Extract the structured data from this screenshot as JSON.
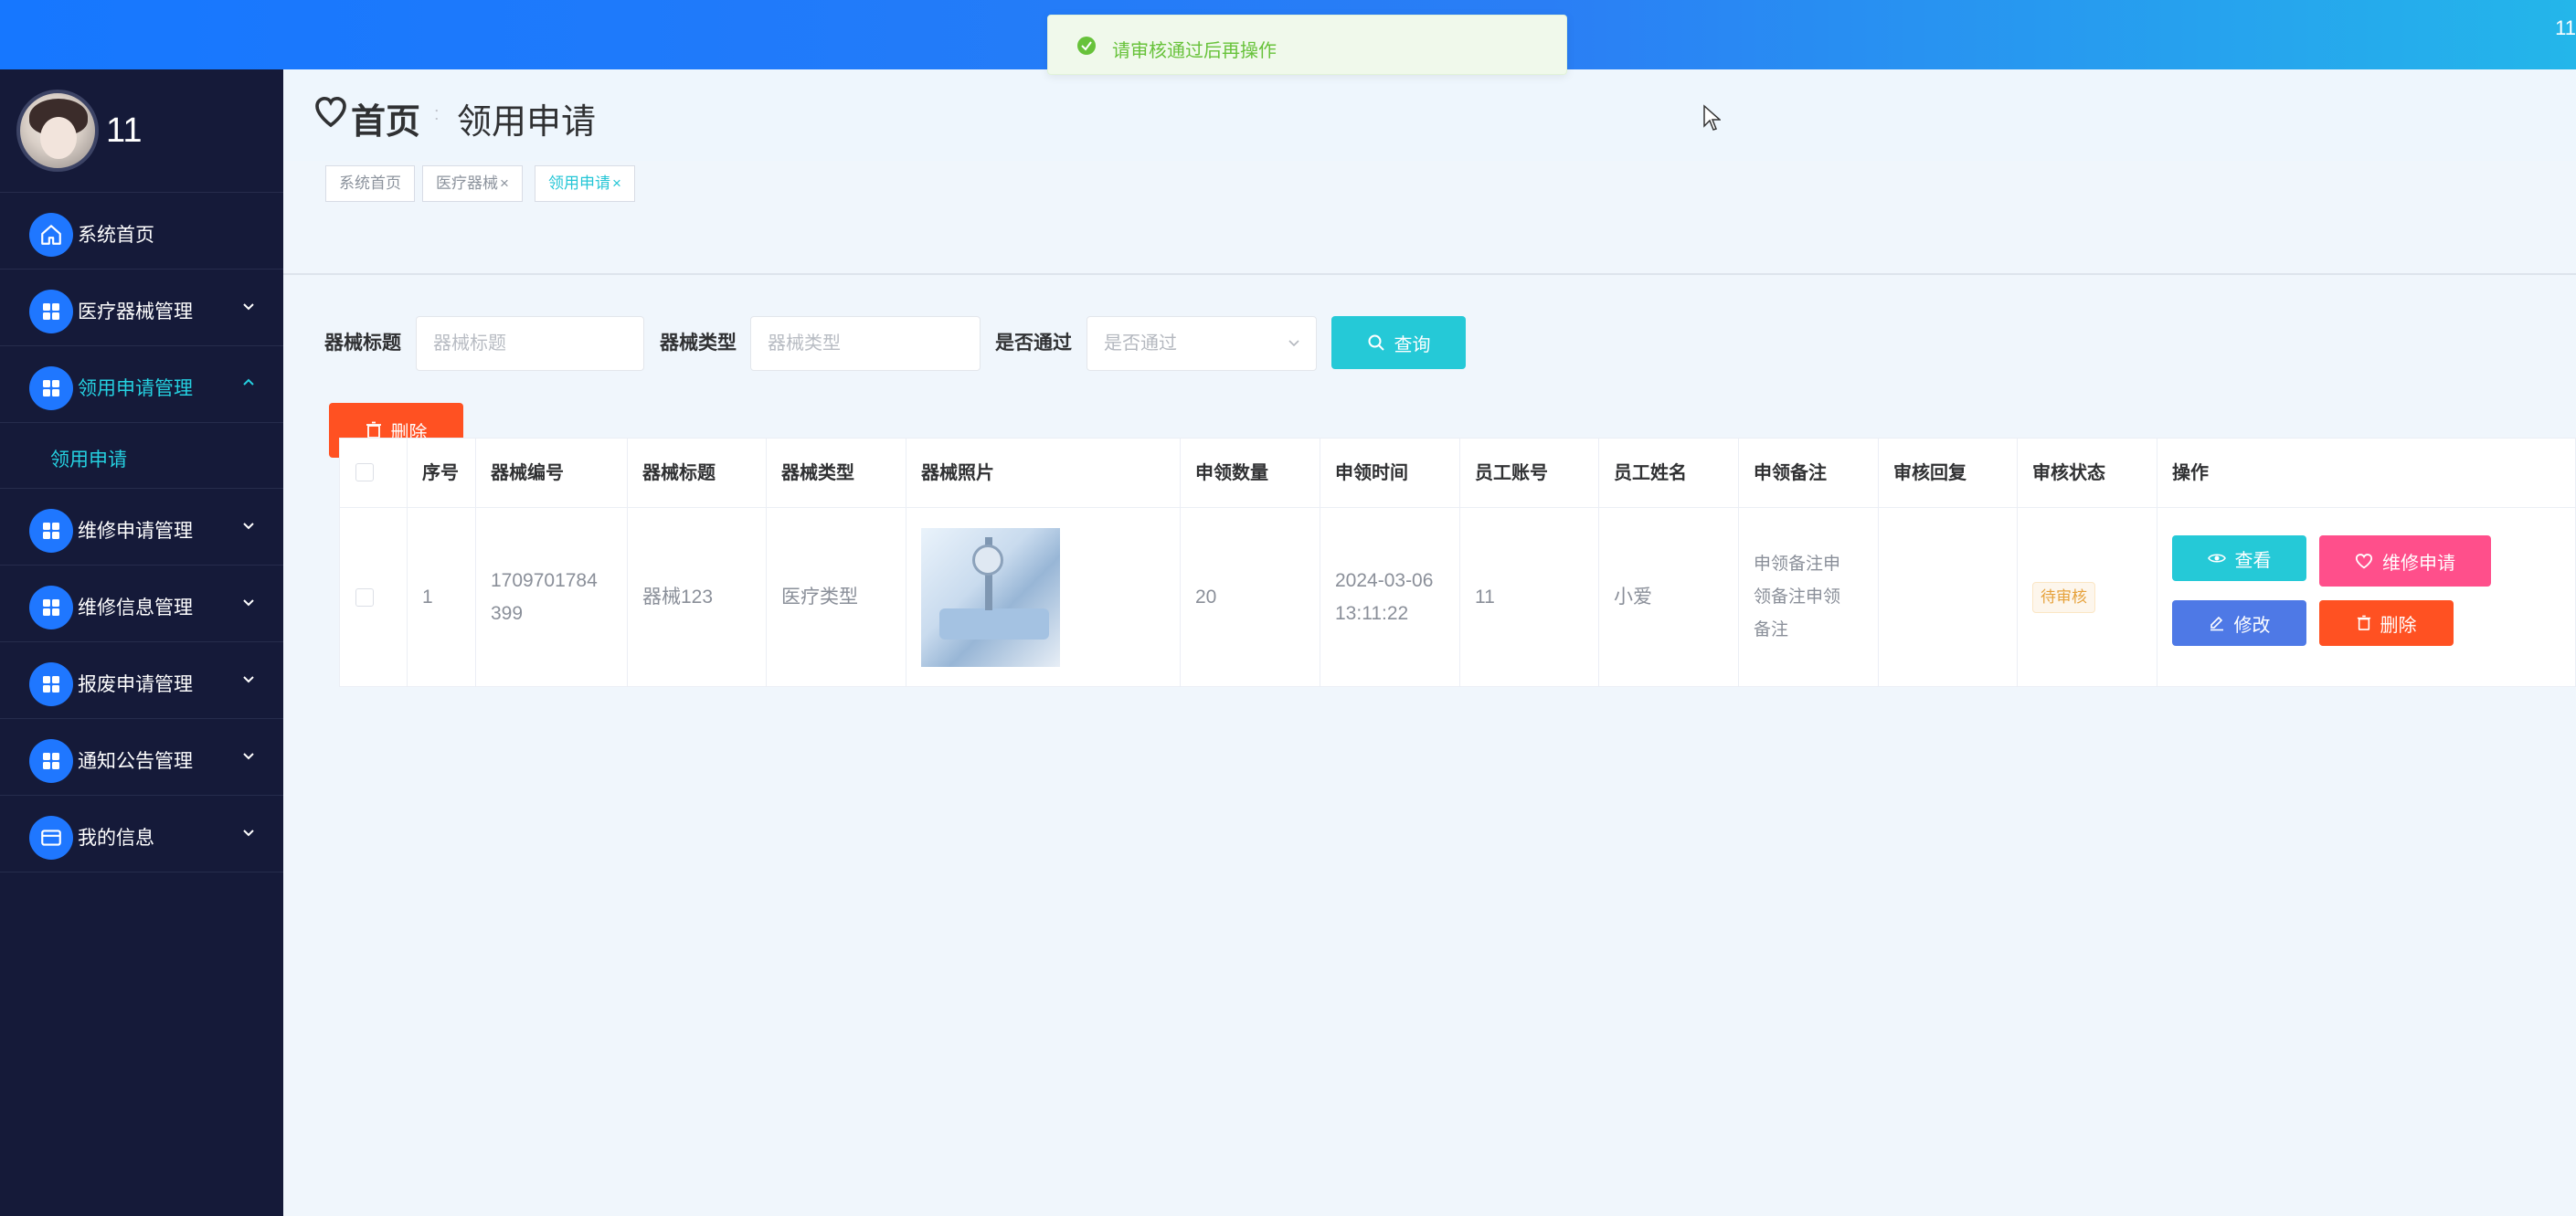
{
  "topbar": {
    "user": "11"
  },
  "toast": {
    "message": "请审核通过后再操作"
  },
  "sidebar": {
    "profile_name": "11",
    "items": [
      {
        "label": "系统首页",
        "icon": "home-icon"
      },
      {
        "label": "医疗器械管理",
        "icon": "grid-icon"
      },
      {
        "label": "领用申请管理",
        "icon": "grid-icon",
        "active": true
      },
      {
        "label": "维修申请管理",
        "icon": "grid-icon"
      },
      {
        "label": "维修信息管理",
        "icon": "grid-icon"
      },
      {
        "label": "报废申请管理",
        "icon": "grid-icon"
      },
      {
        "label": "通知公告管理",
        "icon": "grid-icon"
      },
      {
        "label": "我的信息",
        "icon": "wallet-icon"
      }
    ],
    "submenu": {
      "label": "领用申请"
    }
  },
  "header": {
    "home": "首页",
    "separator": ":",
    "page": "领用申请"
  },
  "tabs": [
    {
      "label": "系统首页"
    },
    {
      "label": "医疗器械",
      "close": "×"
    },
    {
      "label": "领用申请",
      "close": "×"
    }
  ],
  "search": {
    "title_label": "器械标题",
    "title_placeholder": "器械标题",
    "type_label": "器械类型",
    "type_placeholder": "器械类型",
    "pass_label": "是否通过",
    "pass_placeholder": "是否通过",
    "query_button": "查询"
  },
  "toolbar": {
    "delete_button": "删除"
  },
  "table": {
    "headers": [
      "序号",
      "器械编号",
      "器械标题",
      "器械类型",
      "器械照片",
      "申领数量",
      "申领时间",
      "员工账号",
      "员工姓名",
      "申领备注",
      "审核回复",
      "审核状态",
      "操作"
    ],
    "rows": [
      {
        "index": "1",
        "code_line1": "1709701784",
        "code_line2": "399",
        "title": "器械123",
        "type": "医疗类型",
        "quantity": "20",
        "time_line1": "2024-03-06",
        "time_line2": "13:11:22",
        "account": "11",
        "name": "小爱",
        "note_line1": "申领备注申",
        "note_line2": "领备注申领",
        "note_line3": "备注",
        "reply": "",
        "status": "待审核",
        "actions": {
          "view": "查看",
          "repair": "维修申请",
          "edit": "修改",
          "delete": "删除"
        }
      }
    ]
  },
  "colors": {
    "topbar": "#1677ff",
    "sidebar": "#151a39",
    "accent": "#25c9d7",
    "danger": "#ff5122",
    "pink": "#ff4f8b",
    "blue": "#4e79e6",
    "success": "#67c23a"
  }
}
